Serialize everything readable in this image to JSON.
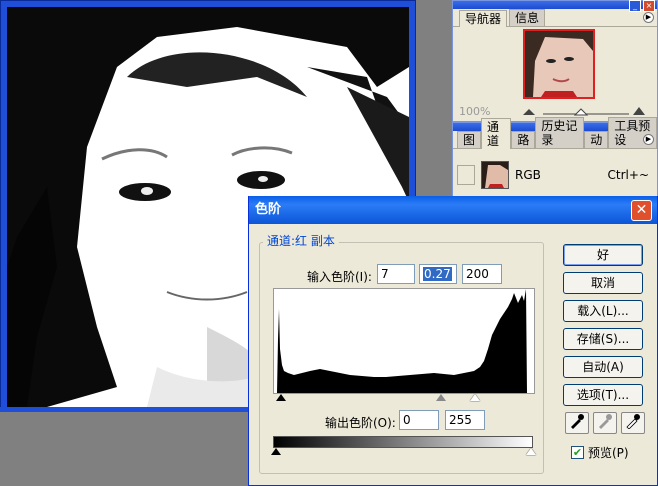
{
  "navigator": {
    "tabs": [
      "导航器",
      "信息"
    ],
    "zoom": "100%"
  },
  "channels": {
    "tabs": [
      "图",
      "通道",
      "路",
      "历史记录",
      "动",
      "工具预设"
    ],
    "row": {
      "name": "RGB",
      "shortcut": "Ctrl+~"
    }
  },
  "levels": {
    "title": "色阶",
    "channel_label": "通道:红 副本",
    "input_label": "输入色阶(I):",
    "input_values": [
      "7",
      "0.27",
      "200"
    ],
    "output_label": "输出色阶(O):",
    "output_values": [
      "0",
      "255"
    ],
    "buttons": {
      "ok": "好",
      "cancel": "取消",
      "load": "载入(L)...",
      "save": "存储(S)...",
      "auto": "自动(A)",
      "options": "选项(T)..."
    },
    "preview_label": "预览(P)",
    "preview_checked": true
  }
}
